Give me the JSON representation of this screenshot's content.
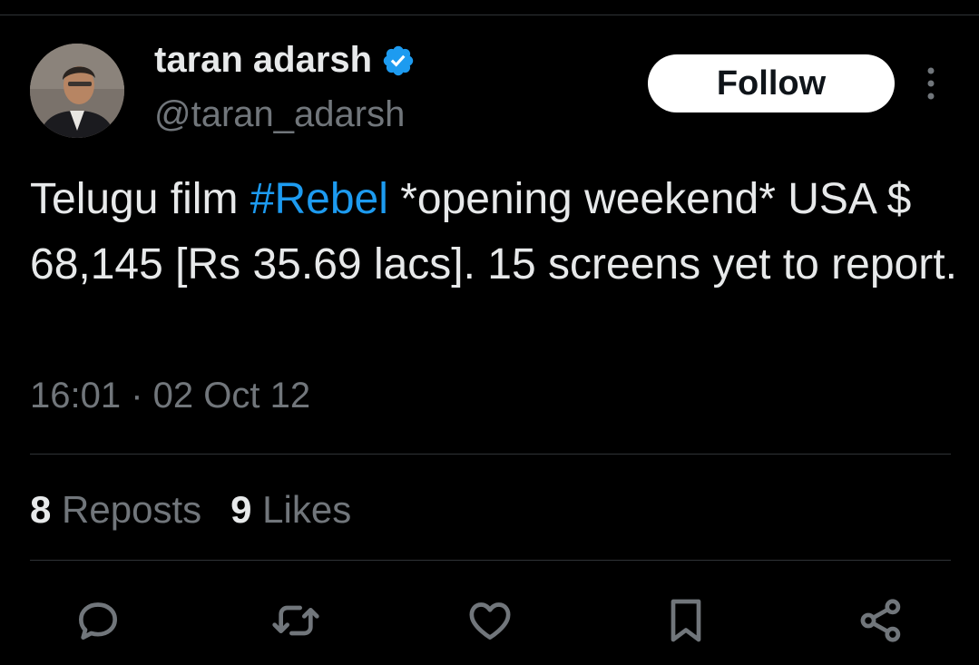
{
  "author": {
    "display_name": "taran adarsh",
    "handle": "@taran_adarsh",
    "verified": true
  },
  "follow_label": "Follow",
  "tweet": {
    "text_before": "Telugu film ",
    "hashtag": "#Rebel",
    "text_after": " *opening weekend* USA $ 68,145 [Rs 35.69 lacs]. 15 screens yet to report.",
    "timestamp": "16:01 · 02 Oct 12"
  },
  "stats": {
    "reposts_count": "8",
    "reposts_label": "Reposts",
    "likes_count": "9",
    "likes_label": "Likes"
  },
  "icons": {
    "more": "more-vertical-icon",
    "reply": "reply-icon",
    "repost": "repost-icon",
    "like": "heart-icon",
    "bookmark": "bookmark-icon",
    "share": "share-icon"
  },
  "colors": {
    "background": "#000000",
    "text": "#e7e9ea",
    "secondary": "#71767b",
    "link": "#1d9bf0",
    "verified": "#1d9bf0"
  }
}
